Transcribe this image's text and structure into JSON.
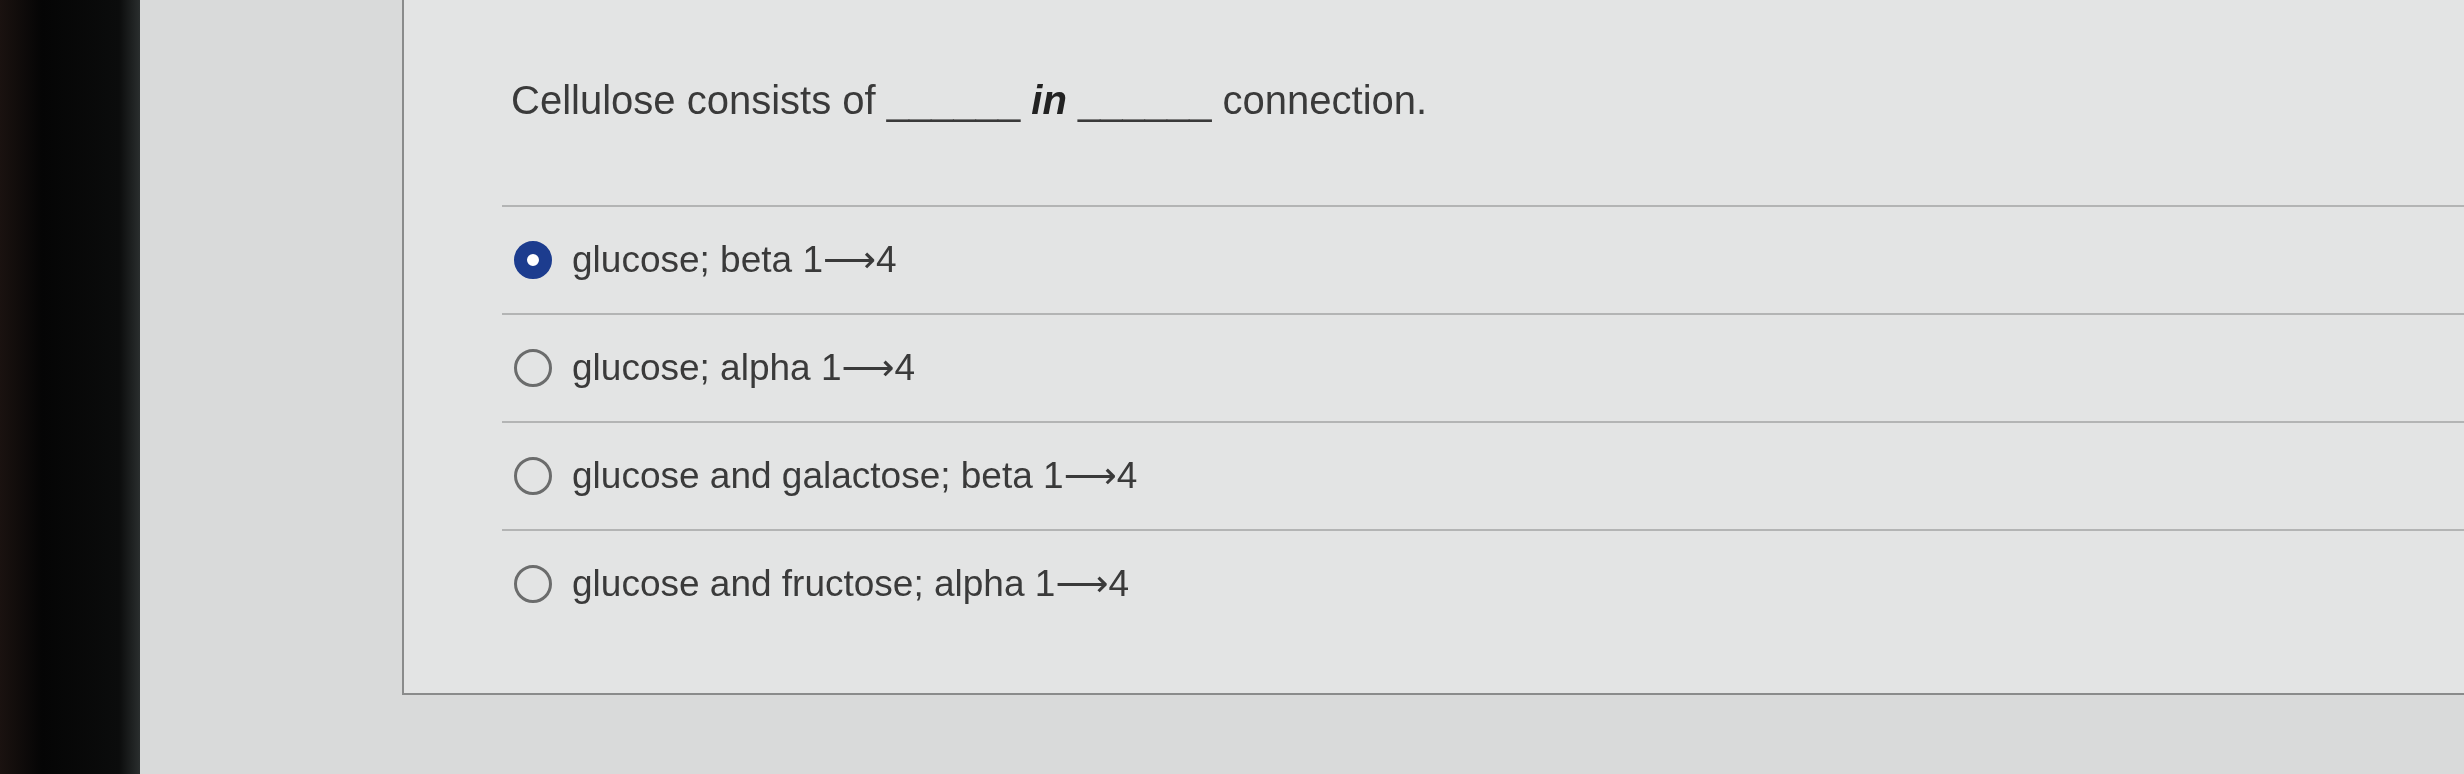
{
  "question": {
    "text": "Cellulose consists of ______ **in** ______ connection."
  },
  "options": [
    {
      "label": "glucose; beta 1⟶4",
      "selected": true
    },
    {
      "label": "glucose; alpha 1⟶4",
      "selected": false
    },
    {
      "label": "glucose and galactose; beta 1⟶4",
      "selected": false
    },
    {
      "label": "glucose and fructose; alpha 1⟶4",
      "selected": false
    }
  ]
}
